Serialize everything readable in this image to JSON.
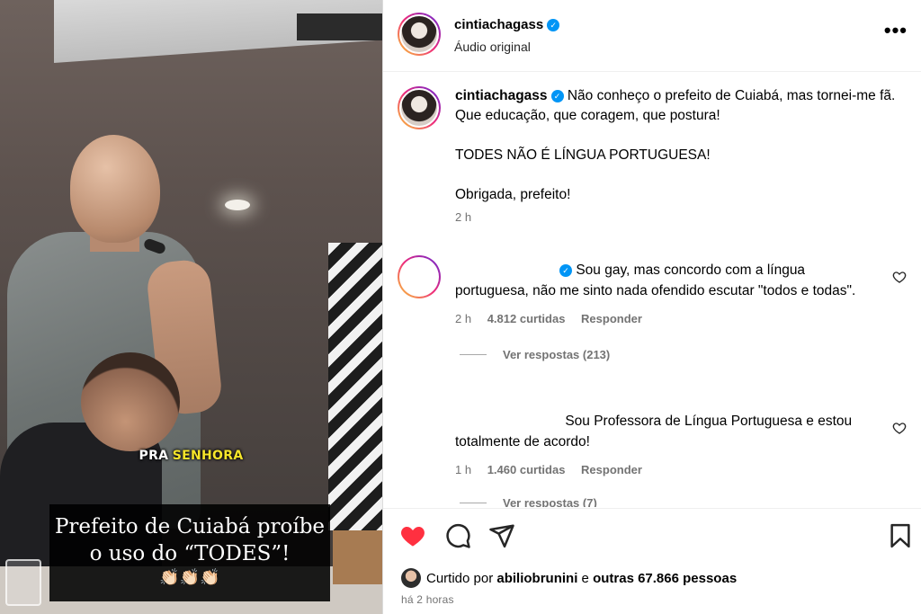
{
  "media": {
    "overlay_text_white": "PRA",
    "overlay_text_yellow": "SENHORA",
    "caption_line1": "Prefeito de Cuiabá proíbe",
    "caption_line2": "o uso do “TODES”!",
    "caption_emoji": "👏🏻👏🏻👏🏻"
  },
  "header": {
    "username": "cintiachagass",
    "verified_icon": "verified-badge-icon",
    "audio_label": "Áudio original",
    "more_icon": "•••"
  },
  "post": {
    "username": "cintiachagass",
    "caption_p1": "Não conheço o prefeito de Cuiabá, mas tornei-me fã. Que educação, que coragem, que postura!",
    "caption_p2": "TODES NÃO É LÍNGUA PORTUGUESA!",
    "caption_p3": "Obrigada, prefeito!",
    "time": "2 h"
  },
  "comments": [
    {
      "text": "Sou gay, mas concordo com a língua portuguesa, não me sinto nada ofendido escutar \"todos e todas\".",
      "time": "2 h",
      "likes": "4.812 curtidas",
      "reply": "Responder",
      "replies_label": "Ver respostas (213)"
    },
    {
      "text": "Sou Professora de Língua Portuguesa e estou totalmente de acordo!",
      "time": "1 h",
      "likes": "1.460 curtidas",
      "reply": "Responder",
      "replies_label": "Ver respostas (7)"
    }
  ],
  "footer": {
    "liked_prefix": "Curtido por",
    "liked_user": "abiliobrunini",
    "liked_and": "e",
    "liked_others": "outras 67.866 pessoas",
    "time_ago": "há 2 horas"
  },
  "colors": {
    "accent_blue": "#0095f6",
    "like_red": "#ff3040",
    "secondary_text": "#737373"
  }
}
